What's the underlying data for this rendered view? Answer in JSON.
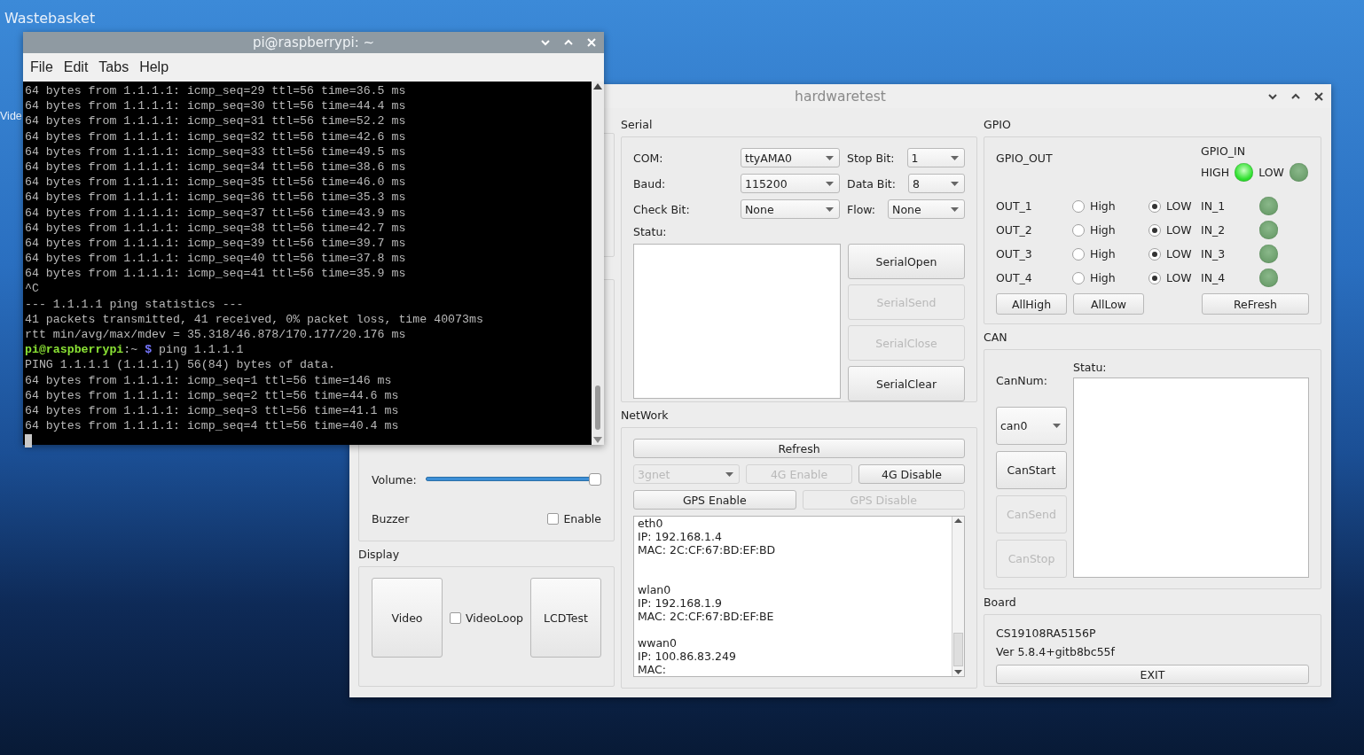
{
  "desktop": {
    "icons": [
      {
        "label": "Wastebasket"
      },
      {
        "label": "Vide"
      }
    ]
  },
  "terminal": {
    "title": "pi@raspberrypi: ~",
    "menu": [
      "File",
      "Edit",
      "Tabs",
      "Help"
    ],
    "lines": [
      {
        "kind": "output",
        "text": "64 bytes from 1.1.1.1: icmp_seq=29 ttl=56 time=36.5 ms"
      },
      {
        "kind": "output",
        "text": "64 bytes from 1.1.1.1: icmp_seq=30 ttl=56 time=44.4 ms"
      },
      {
        "kind": "output",
        "text": "64 bytes from 1.1.1.1: icmp_seq=31 ttl=56 time=52.2 ms"
      },
      {
        "kind": "output",
        "text": "64 bytes from 1.1.1.1: icmp_seq=32 ttl=56 time=42.6 ms"
      },
      {
        "kind": "output",
        "text": "64 bytes from 1.1.1.1: icmp_seq=33 ttl=56 time=49.5 ms"
      },
      {
        "kind": "output",
        "text": "64 bytes from 1.1.1.1: icmp_seq=34 ttl=56 time=38.6 ms"
      },
      {
        "kind": "output",
        "text": "64 bytes from 1.1.1.1: icmp_seq=35 ttl=56 time=46.0 ms"
      },
      {
        "kind": "output",
        "text": "64 bytes from 1.1.1.1: icmp_seq=36 ttl=56 time=35.3 ms"
      },
      {
        "kind": "output",
        "text": "64 bytes from 1.1.1.1: icmp_seq=37 ttl=56 time=43.9 ms"
      },
      {
        "kind": "output",
        "text": "64 bytes from 1.1.1.1: icmp_seq=38 ttl=56 time=42.7 ms"
      },
      {
        "kind": "output",
        "text": "64 bytes from 1.1.1.1: icmp_seq=39 ttl=56 time=39.7 ms"
      },
      {
        "kind": "output",
        "text": "64 bytes from 1.1.1.1: icmp_seq=40 ttl=56 time=37.8 ms"
      },
      {
        "kind": "output",
        "text": "64 bytes from 1.1.1.1: icmp_seq=41 ttl=56 time=35.9 ms"
      },
      {
        "kind": "output",
        "text": "^C"
      },
      {
        "kind": "output",
        "text": "--- 1.1.1.1 ping statistics ---"
      },
      {
        "kind": "output",
        "text": "41 packets transmitted, 41 received, 0% packet loss, time 40073ms"
      },
      {
        "kind": "output",
        "text": "rtt min/avg/max/mdev = 35.318/46.878/170.177/20.176 ms"
      },
      {
        "kind": "prompt",
        "user": "pi@raspberrypi",
        "path": ":~",
        "symbol": "$",
        "command": "ping 1.1.1.1"
      },
      {
        "kind": "output",
        "text": "PING 1.1.1.1 (1.1.1.1) 56(84) bytes of data."
      },
      {
        "kind": "output",
        "text": "64 bytes from 1.1.1.1: icmp_seq=1 ttl=56 time=146 ms"
      },
      {
        "kind": "output",
        "text": "64 bytes from 1.1.1.1: icmp_seq=2 ttl=56 time=44.6 ms"
      },
      {
        "kind": "output",
        "text": "64 bytes from 1.1.1.1: icmp_seq=3 ttl=56 time=41.1 ms"
      },
      {
        "kind": "output",
        "text": "64 bytes from 1.1.1.1: icmp_seq=4 ttl=56 time=40.4 ms"
      },
      {
        "kind": "cursor"
      }
    ]
  },
  "app": {
    "title": "hardwaretest",
    "audio": {
      "volume": {
        "label": "Volume:",
        "level": 1
      },
      "buzzer": {
        "label": "Buzzer",
        "checkbox": {
          "label": "Enable",
          "checked": false
        }
      }
    },
    "display": {
      "title": "Display",
      "items": [
        {
          "kind": "button",
          "label": "Video"
        },
        {
          "kind": "checkbox",
          "label": "VideoLoop",
          "checked": false
        },
        {
          "kind": "button",
          "label": "LCDTest"
        }
      ]
    },
    "serial": {
      "title": "Serial",
      "rows": [
        {
          "left": {
            "label": "COM:",
            "value": "ttyAMA0"
          },
          "right": {
            "label": "Stop Bit:",
            "value": "1"
          }
        },
        {
          "left": {
            "label": "Baud:",
            "value": "115200"
          },
          "right": {
            "label": "Data Bit:",
            "value": "8"
          }
        },
        {
          "left": {
            "label": "Check Bit:",
            "value": "None"
          },
          "right": {
            "label": "Flow:",
            "value": "None"
          }
        }
      ],
      "status_label": "Statu:",
      "buttons": [
        {
          "label": "SerialOpen",
          "disabled": false
        },
        {
          "label": "SerialSend",
          "disabled": true
        },
        {
          "label": "SerialClose",
          "disabled": true
        },
        {
          "label": "SerialClear",
          "disabled": false
        }
      ]
    },
    "network": {
      "title": "NetWork",
      "refresh": {
        "label": "Refresh",
        "disabled": false
      },
      "apn": {
        "value": "3gnet",
        "disabled": true
      },
      "buttons_4g": [
        {
          "label": "4G Enable",
          "disabled": true
        },
        {
          "label": "4G Disable",
          "disabled": false
        }
      ],
      "buttons_gps": [
        {
          "label": "GPS Enable",
          "disabled": false
        },
        {
          "label": "GPS Disable",
          "disabled": true
        }
      ],
      "info": [
        {
          "kind": "line",
          "text": "eth0"
        },
        {
          "kind": "line",
          "text": "IP: 192.168.1.4"
        },
        {
          "kind": "line",
          "text": "MAC: 2C:CF:67:BD:EF:BD"
        },
        {
          "kind": "blank"
        },
        {
          "kind": "blank"
        },
        {
          "kind": "line",
          "text": "wlan0"
        },
        {
          "kind": "line",
          "text": "IP: 192.168.1.9"
        },
        {
          "kind": "line",
          "text": "MAC: 2C:CF:67:BD:EF:BE"
        },
        {
          "kind": "blank"
        },
        {
          "kind": "line",
          "text": "wwan0"
        },
        {
          "kind": "line",
          "text": "IP: 100.86.83.249"
        },
        {
          "kind": "line",
          "text": "MAC:"
        }
      ]
    },
    "gpio": {
      "title": "GPIO",
      "out_title": "GPIO_OUT",
      "in_title": "GPIO_IN",
      "legend": [
        {
          "label": "HIGH",
          "on": true
        },
        {
          "label": "LOW",
          "on": false
        }
      ],
      "outputs": [
        {
          "label": "OUT_1",
          "options": [
            {
              "label": "High",
              "selected": false
            },
            {
              "label": "LOW",
              "selected": true
            }
          ]
        },
        {
          "label": "OUT_2",
          "options": [
            {
              "label": "High",
              "selected": false
            },
            {
              "label": "LOW",
              "selected": true
            }
          ]
        },
        {
          "label": "OUT_3",
          "options": [
            {
              "label": "High",
              "selected": false
            },
            {
              "label": "LOW",
              "selected": true
            }
          ]
        },
        {
          "label": "OUT_4",
          "options": [
            {
              "label": "High",
              "selected": false
            },
            {
              "label": "LOW",
              "selected": true
            }
          ]
        }
      ],
      "inputs": [
        {
          "label": "IN_1",
          "on": false
        },
        {
          "label": "IN_2",
          "on": false
        },
        {
          "label": "IN_3",
          "on": false
        },
        {
          "label": "IN_4",
          "on": false
        }
      ],
      "buttons": [
        {
          "label": "AllHigh"
        },
        {
          "label": "AllLow"
        }
      ],
      "refresh": {
        "label": "ReFresh"
      }
    },
    "can": {
      "title": "CAN",
      "num_label": "CanNum:",
      "select": {
        "value": "can0"
      },
      "status_label": "Statu:",
      "buttons": [
        {
          "label": "CanStart",
          "disabled": false
        },
        {
          "label": "CanSend",
          "disabled": true
        },
        {
          "label": "CanStop",
          "disabled": true
        }
      ]
    },
    "board": {
      "title": "Board",
      "lines": [
        "CS19108RA5156P",
        "Ver 5.8.4+gitb8bc55f"
      ],
      "button": {
        "label": "EXIT"
      }
    }
  }
}
